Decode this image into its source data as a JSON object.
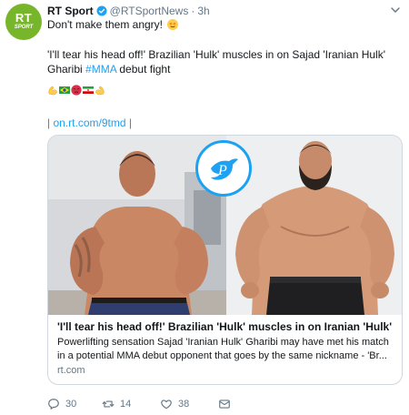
{
  "account": {
    "avatar_text": "RT",
    "avatar_subtext": "SPORT",
    "name": "RT Sport",
    "handle": "@RTSportNews",
    "separator": "·",
    "time": "3h",
    "verified_icon": "verified-badge-icon",
    "colors": {
      "avatar_bg": "#77b62b",
      "verified": "#1da1f2"
    }
  },
  "tweet": {
    "line1": "Don't make them angry!",
    "line1_emoji": "face-emoji-icon",
    "line2a": "'I'll tear his head off!' Brazilian 'Hulk' muscles in on Sajad 'Iranian Hulk' Gharibi",
    "hashtag": "#MMA",
    "line2b": " debut fight",
    "emojis": [
      "flexed-biceps-icon",
      "brazil-flag-icon",
      "angry-face-icon",
      "iran-flag-icon",
      "flexed-biceps-icon"
    ],
    "link_prefix": "|",
    "link": "on.rt.com/9tmd",
    "link_suffix": "|"
  },
  "card": {
    "title": "'I'll tear his head off!' Brazilian 'Hulk' muscles in on Iranian 'Hulk' MM...",
    "description_line1": "Powerlifting sensation Sajad 'Iranian Hulk' Gharibi may have met his match",
    "description_line2": "in a potential MMA debut opponent that goes by the same nickname - 'Br...",
    "domain": "rt.com",
    "image_left": "brazilian-hulk-photo",
    "image_right": "iranian-hulk-photo",
    "watermark": "bird-logo-watermark-icon"
  },
  "actions": {
    "reply_count": "30",
    "retweet_count": "14",
    "like_count": "38",
    "icons": [
      "reply-icon",
      "retweet-icon",
      "like-icon",
      "message-icon"
    ]
  }
}
